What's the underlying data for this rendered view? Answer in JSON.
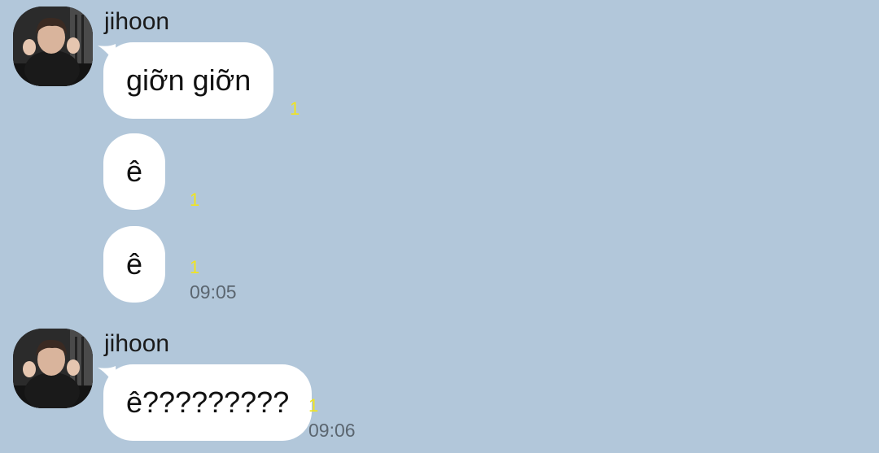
{
  "chat": {
    "groups": [
      {
        "sender": "jihoon",
        "messages": [
          {
            "text": "giỡn giỡn",
            "unread": "1"
          },
          {
            "text": "ê",
            "unread": "1"
          },
          {
            "text": "ê",
            "unread": "1",
            "time": "09:05"
          }
        ]
      },
      {
        "sender": "jihoon",
        "messages": [
          {
            "text": "ê?????????",
            "unread": "1",
            "time": "09:06"
          }
        ]
      }
    ]
  },
  "colors": {
    "background": "#b2c7da",
    "bubble": "#ffffff",
    "unread_count": "#f2e51d",
    "timestamp": "#5b6670"
  },
  "icons": {
    "avatar": "profile-photo-avatar"
  }
}
